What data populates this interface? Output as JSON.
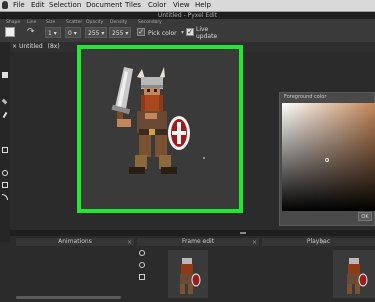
{
  "menubar": {
    "items": [
      "File",
      "Edit",
      "Selection",
      "Document",
      "Tiles",
      "Color",
      "View",
      "Help"
    ]
  },
  "window": {
    "title": "Untitled - Pyxel Edit"
  },
  "toolbar": {
    "shape_label": "Shape",
    "line_label": "Line",
    "size_label": "Size",
    "size_value": "1",
    "scatter_label": "Scatter",
    "scatter_value": "0",
    "opacity_label": "Opacity",
    "opacity_value": "255",
    "density_label": "Density",
    "density_value": "255",
    "secondary_label": "Secondary",
    "pick_color_label": "Pick color",
    "live_update_label": "Live update"
  },
  "document_tab": {
    "label": "Untitled",
    "zoom": "(8x)"
  },
  "foreground_panel": {
    "title": "Foreground color",
    "ok_label": "OK"
  },
  "bottom_panels": {
    "animations": "Animations",
    "frame_edit": "Frame edit",
    "playback": "Playbac"
  },
  "colors": {
    "highlight_frame": "#22e834",
    "viking_skin": "#c2865a",
    "shield_red": "#9a1d1d"
  }
}
